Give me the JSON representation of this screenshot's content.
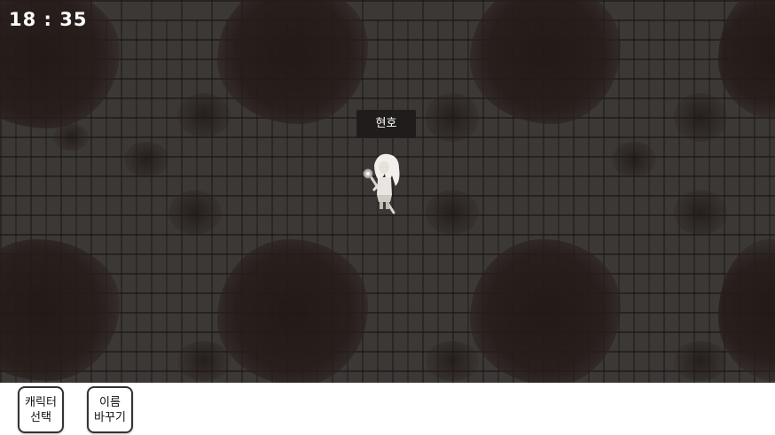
{
  "hud": {
    "clock": "18 : 35"
  },
  "player": {
    "name": "현호",
    "sprite": "white-haired-character-with-staff"
  },
  "buttons": {
    "character_select": {
      "line1": "캐릭터",
      "line2": "선택"
    },
    "rename": {
      "line1": "이름",
      "line2": "바꾸기"
    }
  },
  "colors": {
    "floor": "#3c3836",
    "name_tag_bg": "#1f1c1b",
    "text_light": "#ffffff",
    "button_border": "#333333"
  }
}
